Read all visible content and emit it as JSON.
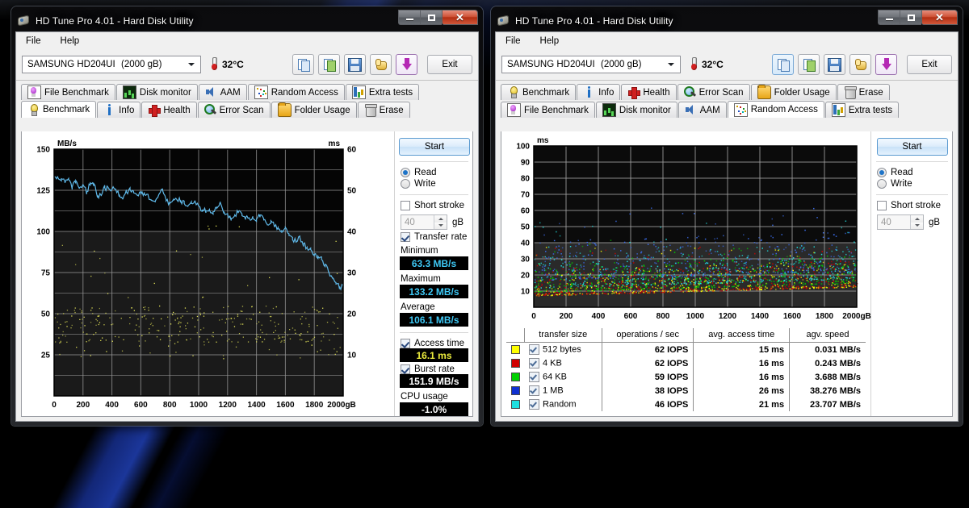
{
  "app": {
    "title": "HD Tune Pro 4.01 - Hard Disk Utility",
    "menu": [
      "File",
      "Help"
    ],
    "drive": "SAMSUNG HD204UI",
    "capacity": "(2000 gB)",
    "temperature": "32°C",
    "exit_label": "Exit",
    "window_buttons": {
      "minimize": "–",
      "maximize": "□",
      "close": "✕"
    }
  },
  "tabs": {
    "row_a": [
      "File Benchmark",
      "Disk monitor",
      "AAM",
      "Random Access",
      "Extra tests"
    ],
    "row_b": [
      "Benchmark",
      "Info",
      "Health",
      "Error Scan",
      "Folder Usage",
      "Erase"
    ],
    "left_active": "Benchmark",
    "right_active": "Random Access"
  },
  "left_panel": {
    "start_label": "Start",
    "read_label": "Read",
    "write_label": "Write",
    "short_stroke_label": "Short stroke",
    "short_stroke_value": "40",
    "short_stroke_unit": "gB",
    "transfer_rate_label": "Transfer rate",
    "minimum_label": "Minimum",
    "minimum_value": "63.3 MB/s",
    "maximum_label": "Maximum",
    "maximum_value": "133.2 MB/s",
    "average_label": "Average",
    "average_value": "106.1 MB/s",
    "access_time_label": "Access time",
    "access_time_value": "16.1 ms",
    "burst_rate_label": "Burst rate",
    "burst_rate_value": "151.9 MB/s",
    "cpu_usage_label": "CPU usage",
    "cpu_usage_value": "-1.0%"
  },
  "right_panel": {
    "start_label": "Start",
    "read_label": "Read",
    "write_label": "Write",
    "short_stroke_label": "Short stroke",
    "short_stroke_value": "40",
    "short_stroke_unit": "gB"
  },
  "results": {
    "headers": [
      "transfer size",
      "operations / sec",
      "avg. access time",
      "agv. speed"
    ],
    "rows": [
      {
        "color": "#ffff00",
        "name": "512 bytes",
        "iops": "62 IOPS",
        "access": "15 ms",
        "speed": "0.031 MB/s"
      },
      {
        "color": "#d00000",
        "name": "4 KB",
        "iops": "62 IOPS",
        "access": "16 ms",
        "speed": "0.243 MB/s"
      },
      {
        "color": "#00d000",
        "name": "64 KB",
        "iops": "59 IOPS",
        "access": "16 ms",
        "speed": "3.688 MB/s"
      },
      {
        "color": "#1030d0",
        "name": "1 MB",
        "iops": "38 IOPS",
        "access": "26 ms",
        "speed": "38.276 MB/s"
      },
      {
        "color": "#20e0e0",
        "name": "Random",
        "iops": "46 IOPS",
        "access": "21 ms",
        "speed": "23.707 MB/s"
      }
    ]
  },
  "chart_data": [
    {
      "type": "line",
      "id": "benchmark-chart",
      "title": "",
      "ylabel": "MB/s",
      "ylabel_right": "ms",
      "xlabel": "gB",
      "ylim": [
        0,
        150
      ],
      "ylim_right": [
        0,
        60
      ],
      "xlim": [
        0,
        2000
      ],
      "yticks": [
        25,
        50,
        75,
        100,
        125,
        150
      ],
      "yticks_right": [
        10,
        20,
        30,
        40,
        50,
        60
      ],
      "xticks": [
        0,
        200,
        400,
        600,
        800,
        1000,
        1200,
        1400,
        1600,
        1800,
        2000
      ],
      "grid": true,
      "background": "#050505",
      "series": [
        {
          "name": "Transfer rate",
          "color": "#5fb8e8",
          "type": "line",
          "x": [
            0,
            25,
            50,
            75,
            100,
            125,
            150,
            175,
            200,
            225,
            250,
            275,
            300,
            325,
            350,
            375,
            400,
            425,
            450,
            475,
            500,
            525,
            550,
            575,
            600,
            625,
            650,
            675,
            700,
            725,
            750,
            775,
            800,
            825,
            850,
            875,
            900,
            925,
            950,
            975,
            1000,
            1025,
            1050,
            1075,
            1100,
            1125,
            1150,
            1175,
            1200,
            1225,
            1250,
            1275,
            1300,
            1325,
            1350,
            1375,
            1400,
            1425,
            1450,
            1475,
            1500,
            1525,
            1550,
            1575,
            1600,
            1625,
            1650,
            1675,
            1700,
            1725,
            1750,
            1775,
            1800,
            1825,
            1850,
            1875,
            1900,
            1925,
            1950,
            1975,
            2000
          ],
          "y": [
            133.2,
            132.8,
            132.0,
            129.5,
            131.5,
            127.0,
            131.0,
            126.5,
            128.5,
            124.0,
            129.5,
            129.0,
            122.0,
            121.5,
            126.5,
            126.0,
            125.5,
            126.0,
            122.5,
            119.5,
            124.0,
            125.5,
            123.5,
            122.0,
            122.5,
            122.5,
            122.0,
            119.0,
            118.5,
            122.5,
            125.0,
            118.5,
            117.0,
            119.0,
            119.0,
            119.0,
            117.0,
            115.5,
            117.0,
            118.5,
            115.5,
            113.0,
            112.5,
            113.0,
            112.0,
            114.0,
            117.5,
            112.0,
            110.5,
            108.0,
            110.0,
            112.0,
            109.5,
            108.5,
            108.0,
            108.0,
            107.5,
            110.0,
            107.0,
            104.0,
            106.5,
            103.0,
            101.5,
            100.5,
            102.5,
            97.5,
            95.0,
            94.0,
            96.5,
            92.5,
            90.0,
            89.0,
            86.0,
            85.0,
            83.0,
            80.0,
            75.5,
            72.0,
            68.0,
            66.5,
            66.0
          ]
        },
        {
          "name": "Access time",
          "color": "#e8e85a",
          "type": "scatter",
          "ymin": 5,
          "ymax": 45,
          "note": "access-time samples plotted against the right-hand ms axis; bulk clustered 14-22 ms"
        }
      ]
    },
    {
      "type": "scatter",
      "id": "random-access-chart",
      "title": "",
      "ylabel": "ms",
      "xlabel": "gB",
      "ylim": [
        0,
        100
      ],
      "xlim": [
        0,
        2000
      ],
      "yticks": [
        10,
        20,
        30,
        40,
        50,
        60,
        70,
        80,
        90,
        100
      ],
      "xticks": [
        0,
        200,
        400,
        600,
        800,
        1000,
        1200,
        1400,
        1600,
        1800,
        2000
      ],
      "grid": true,
      "background": "#111111",
      "series": [
        {
          "name": "512 bytes",
          "color": "#ffff00",
          "count": 520,
          "ms_range": [
            4,
            26
          ]
        },
        {
          "name": "4 KB",
          "color": "#d00000",
          "count": 520,
          "ms_range": [
            4,
            26
          ]
        },
        {
          "name": "64 KB",
          "color": "#00d000",
          "count": 500,
          "ms_range": [
            6,
            30
          ]
        },
        {
          "name": "1 MB",
          "color": "#3c6ff0",
          "count": 420,
          "ms_range": [
            12,
            45
          ]
        },
        {
          "name": "Random",
          "color": "#20e0e0",
          "count": 460,
          "ms_range": [
            8,
            36
          ]
        }
      ]
    }
  ]
}
